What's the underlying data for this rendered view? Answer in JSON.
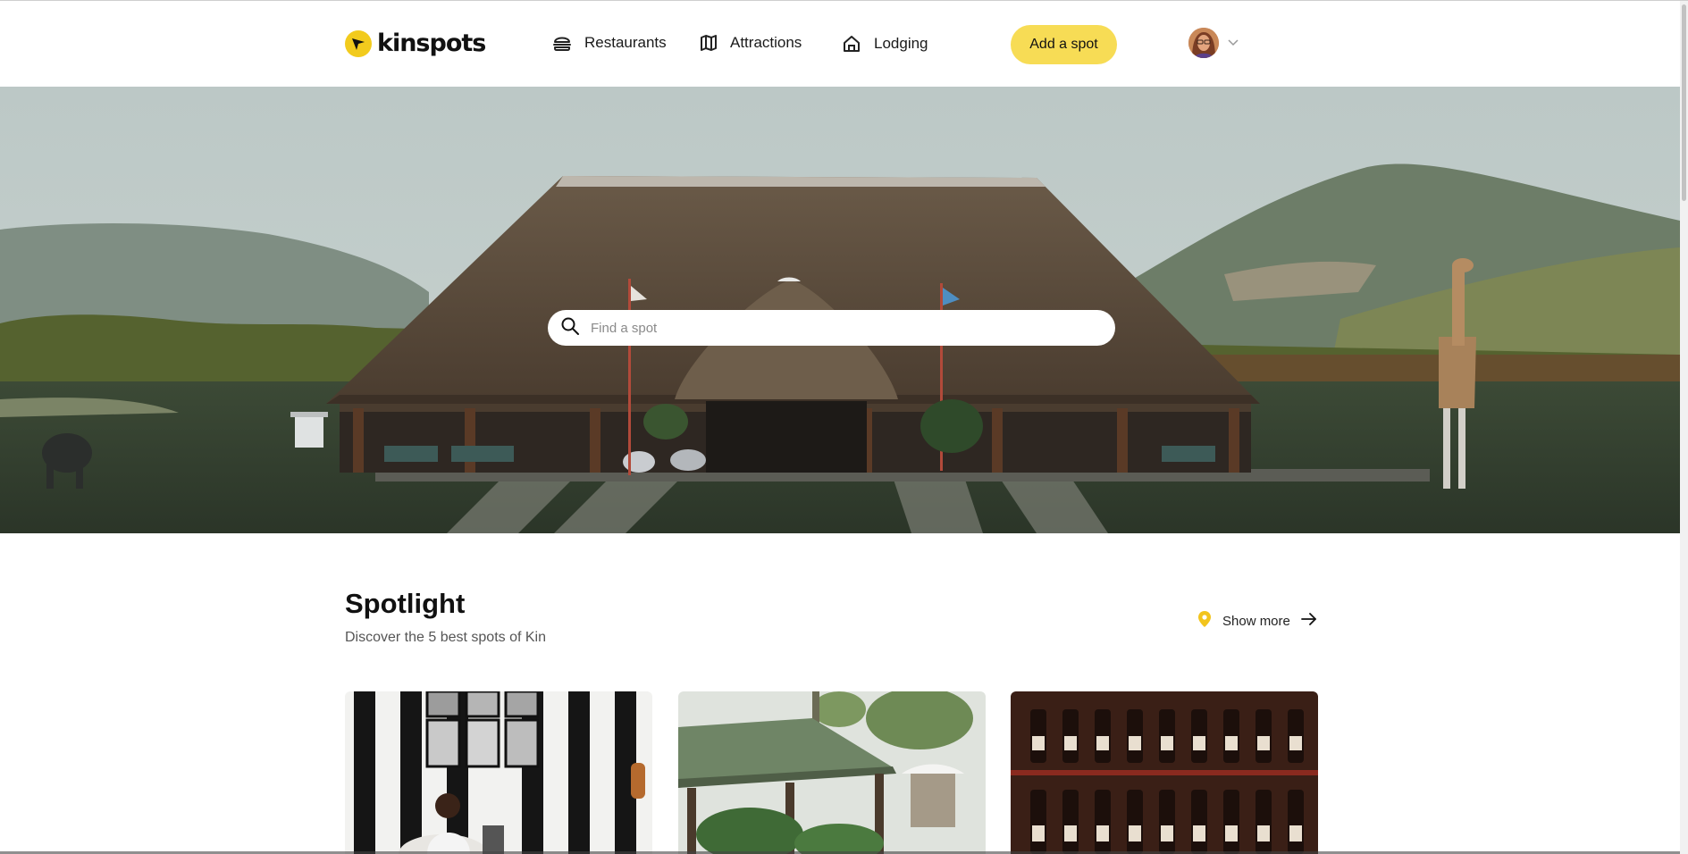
{
  "brand": {
    "name": "kinspots",
    "accent": "#f2cb1d"
  },
  "nav": {
    "items": [
      {
        "label": "Restaurants",
        "icon": "burger-icon"
      },
      {
        "label": "Attractions",
        "icon": "map-icon"
      },
      {
        "label": "Lodging",
        "icon": "house-icon"
      }
    ],
    "add_spot_label": "Add a spot",
    "add_spot_color": "#f7dc55"
  },
  "hero": {
    "search_placeholder": "Find a spot"
  },
  "spotlight": {
    "title": "Spotlight",
    "subtitle": "Discover the 5 best spots of Kin",
    "show_more_label": "Show more"
  }
}
